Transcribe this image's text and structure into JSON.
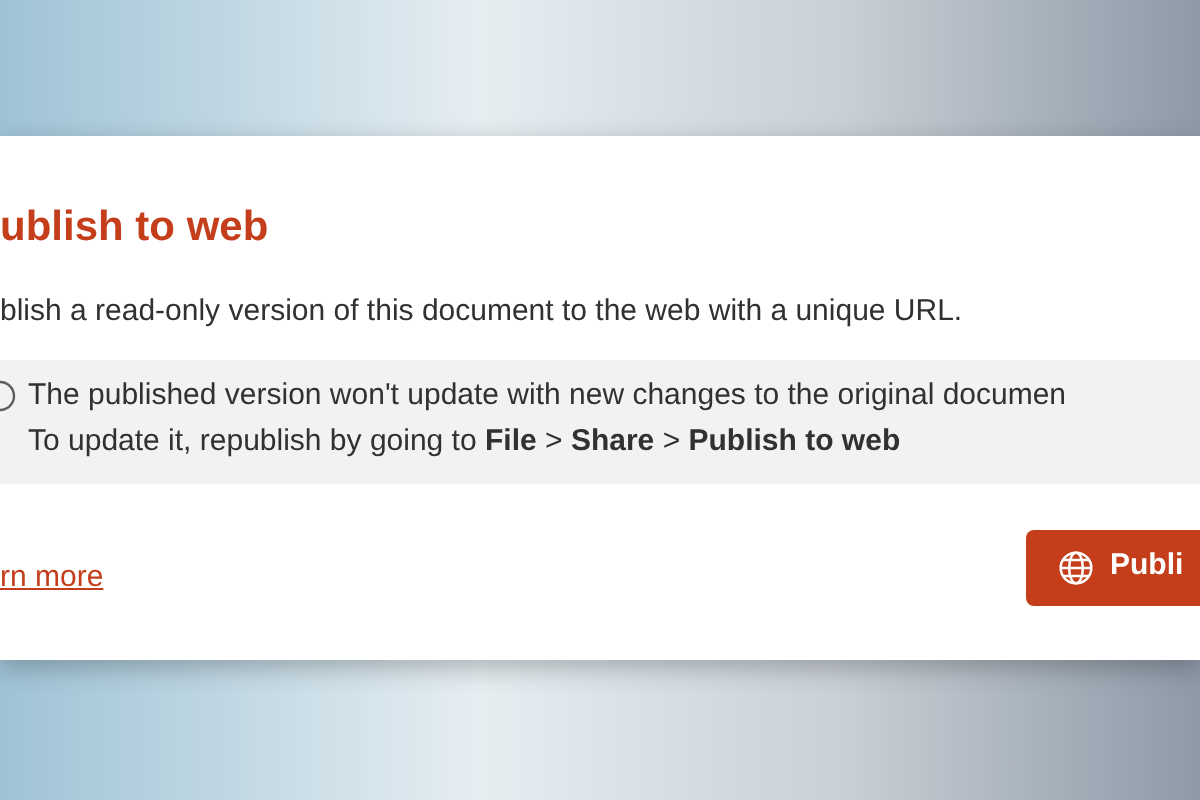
{
  "dialog": {
    "title": "ublish to web",
    "description": "blish a read-only version of this document to the web with a unique URL.",
    "notice": {
      "lines": [
        "The published version won't update with new changes to the original documen",
        "To update it, republish by going to **File** > **Share** > **Publish to web**"
      ]
    },
    "link": "rn more",
    "button": {
      "label": "Publi"
    }
  }
}
